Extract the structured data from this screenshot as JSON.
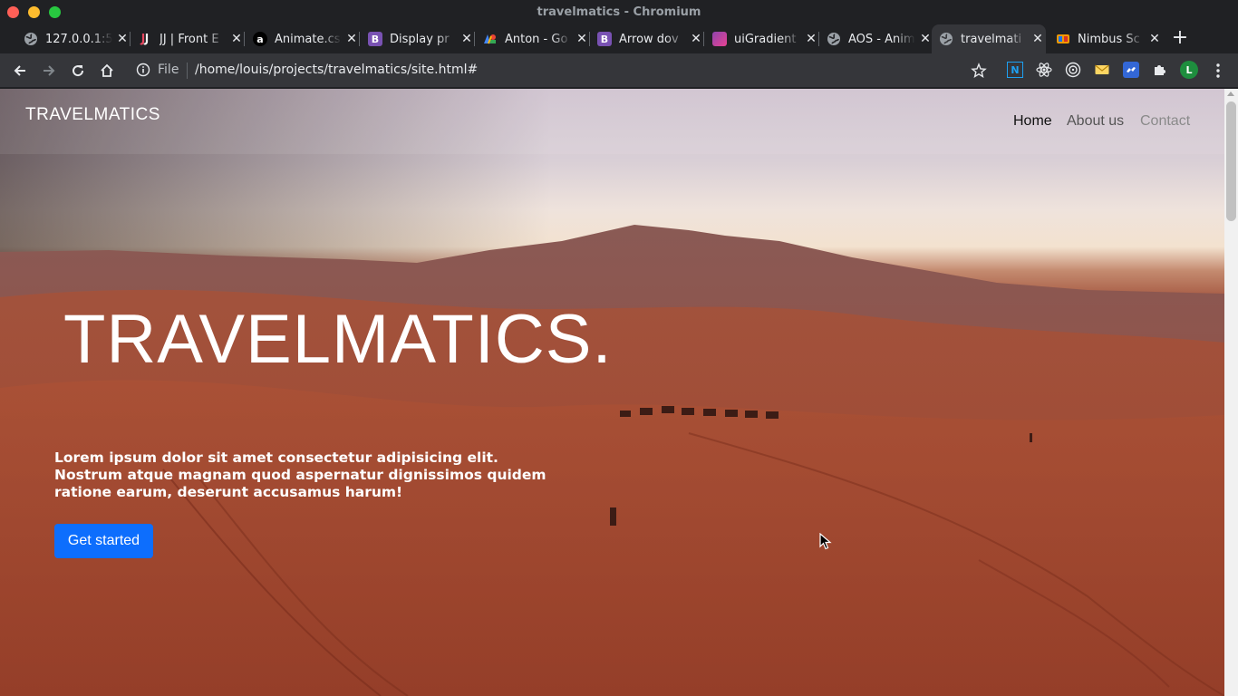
{
  "window": {
    "title": "travelmatics - Chromium"
  },
  "tabs": [
    {
      "label": "127.0.0.1:5",
      "icon": "globe-icon",
      "color": "#9aa0a6"
    },
    {
      "label": "JJ | Front E",
      "icon": "jj-logo-icon",
      "color": "#e8475f"
    },
    {
      "label": "Animate.css",
      "icon": "amazon-icon",
      "color": "#000000"
    },
    {
      "label": "Display pr",
      "icon": "bootstrap-icon",
      "color": "#7952b3"
    },
    {
      "label": "Anton - Go",
      "icon": "google-fonts-icon",
      "color": "#ea4335"
    },
    {
      "label": "Arrow dov",
      "icon": "bootstrap-icon",
      "color": "#7952b3"
    },
    {
      "label": "uiGradient",
      "icon": "gradient-icon",
      "color": "#b83280"
    },
    {
      "label": "AOS - Anim",
      "icon": "globe-icon",
      "color": "#9aa0a6"
    },
    {
      "label": "travelmati",
      "icon": "globe-icon",
      "color": "#9aa0a6",
      "active": true
    },
    {
      "label": "Nimbus Sc",
      "icon": "fonts-icon",
      "color": "#f29900"
    }
  ],
  "toolbar": {
    "scheme": "File",
    "url": "/home/louis/projects/travelmatics/site.html#",
    "profile_initial": "L"
  },
  "page": {
    "brand": "TRAVELMATICS",
    "nav": {
      "home": "Home",
      "about": "About us",
      "contact": "Contact"
    },
    "hero_title": "TRAVELMATICS.",
    "hero_text": "Lorem ipsum dolor sit amet consectetur adipisicing elit. Nostrum atque magnam quod aspernatur dignissimos quidem ratione earum, deserunt accusamus harum!",
    "cta_label": "Get started"
  },
  "colors": {
    "accent": "#0d6efd",
    "titlebar": "#202124",
    "toolbar": "#35363a"
  }
}
